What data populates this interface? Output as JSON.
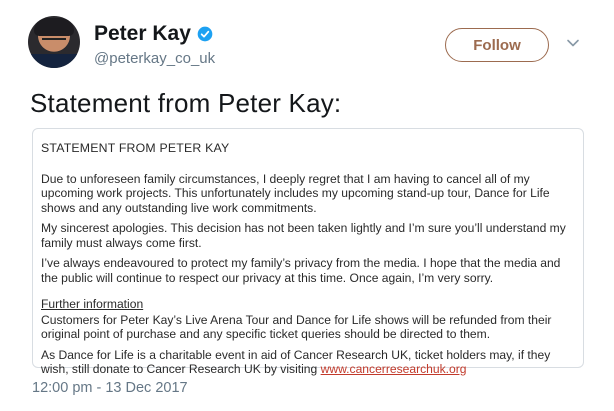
{
  "colors": {
    "follow_accent": "#9c6b4f",
    "verified": "#1da1f2",
    "link": "#c23a2b",
    "muted": "#657786"
  },
  "author": {
    "display_name": "Peter Kay",
    "handle": "@peterkay_co_uk",
    "avatar_icon": "avatar-photo",
    "verified_icon": "verified-badge-icon"
  },
  "actions": {
    "follow_label": "Follow",
    "more_icon": "chevron-down-icon"
  },
  "tweet": {
    "text": "Statement from Peter Kay:",
    "timestamp": "12:00 pm - 13 Dec 2017"
  },
  "statement": {
    "title": "STATEMENT FROM PETER KAY",
    "p1": "Due to unforeseen family circumstances, I deeply regret that I am having to cancel all of my upcoming work projects. This unfortunately includes my upcoming stand-up tour, Dance for Life shows and any outstanding live work commitments.",
    "p2": "My sincerest apologies. This decision has not been taken lightly and I’m sure you’ll understand my family must always come first.",
    "p3": "I’ve always endeavoured to protect my family’s privacy from the media. I hope that the media and the public will continue to respect our privacy at this time. Once again, I’m very sorry.",
    "further_heading": "Further information",
    "p4": "Customers for Peter Kay’s Live Arena Tour and Dance for Life shows will be refunded from their original point of purchase and any specific ticket queries should be directed to them.",
    "p5_prefix": "As Dance for Life is a charitable event in aid of Cancer Research UK, ticket holders may, if they wish, still donate to Cancer Research UK by visiting ",
    "p5_link": "www.cancerresearchuk.org"
  }
}
